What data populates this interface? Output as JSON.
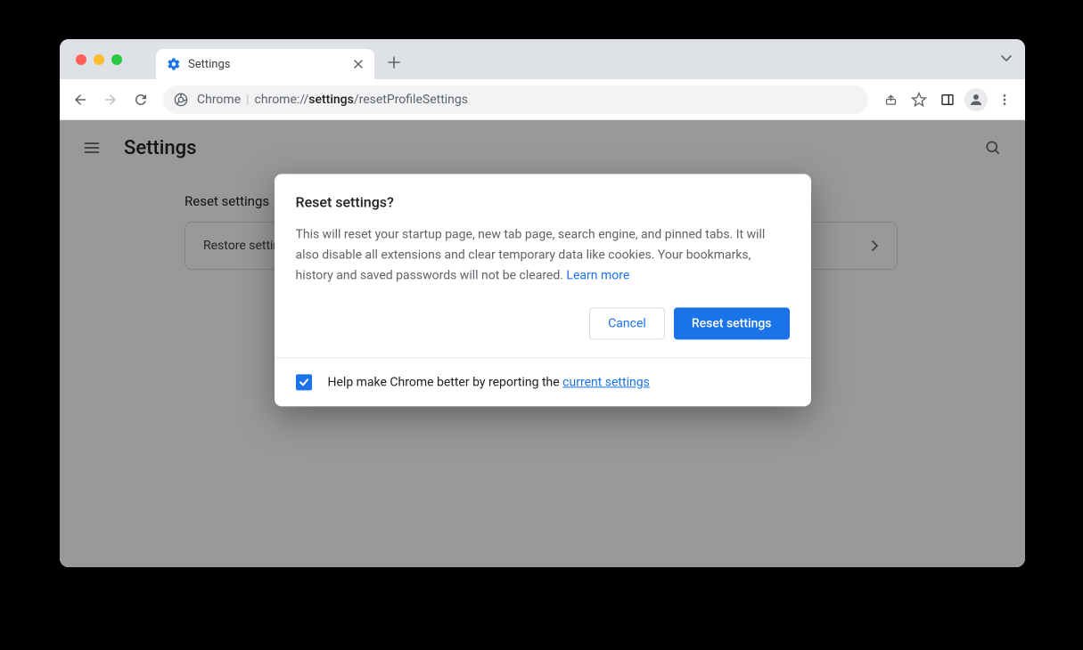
{
  "tab": {
    "title": "Settings"
  },
  "omnibox": {
    "app": "Chrome",
    "scheme": "chrome://",
    "bold": "settings",
    "rest": "/resetProfileSettings"
  },
  "header": {
    "title": "Settings"
  },
  "section": {
    "title": "Reset settings"
  },
  "card": {
    "label": "Restore settings to their original defaults"
  },
  "dialog": {
    "title": "Reset settings?",
    "text": "This will reset your startup page, new tab page, search engine, and pinned tabs. It will also disable all extensions and clear temporary data like cookies. Your bookmarks, history and saved passwords will not be cleared.",
    "learn_more": " Learn more",
    "cancel": "Cancel",
    "confirm": "Reset settings",
    "footer_text": "Help make Chrome better by reporting the ",
    "footer_link": "current settings"
  }
}
